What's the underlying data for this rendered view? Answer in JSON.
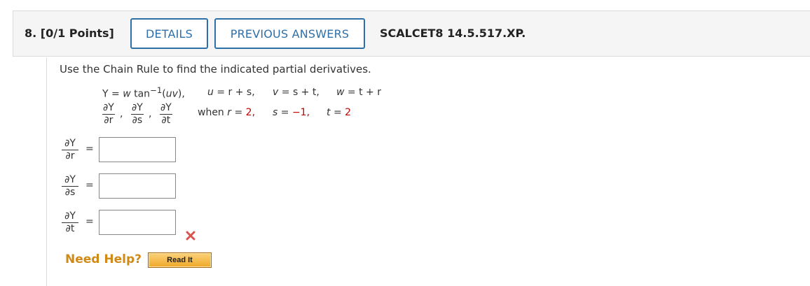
{
  "question": {
    "number_points": "8. [0/1 Points]",
    "details_label": "DETAILS",
    "previous_answers_label": "PREVIOUS ANSWERS",
    "code": "SCALCET8 14.5.517.XP."
  },
  "problem": {
    "instruction": "Use the Chain Rule to find the indicated partial derivatives.",
    "eq1": {
      "Y": "Y",
      "eq": " = ",
      "w": "w",
      "tan": " tan",
      "sup": "−1",
      "open": "(",
      "uv": "uv",
      "close": "),",
      "u_label": "u",
      "u_rhs": "r + s,",
      "v_label": "v",
      "v_rhs": "s + t,",
      "w_label": "w",
      "w_rhs": "t + r"
    },
    "derivs": {
      "dY": "∂Y",
      "dr": "∂r",
      "ds": "∂s",
      "dt": "∂t",
      "comma": ","
    },
    "when": {
      "text": "when",
      "r": "r",
      "r_val": "2,",
      "s": "s",
      "s_val": "−1,",
      "t": "t",
      "t_val": "2"
    }
  },
  "answers": [
    {
      "num": "∂Y",
      "den": "∂r",
      "eq": "=",
      "value": ""
    },
    {
      "num": "∂Y",
      "den": "∂s",
      "eq": "=",
      "value": ""
    },
    {
      "num": "∂Y",
      "den": "∂t",
      "eq": "=",
      "value": ""
    }
  ],
  "colors": {
    "accent": "#2e6fa8",
    "incorrect": "#d9534f",
    "help": "#d08a17",
    "given_values": "#c00000"
  },
  "help": {
    "need_help": "Need Help?",
    "read_it": "Read It"
  }
}
